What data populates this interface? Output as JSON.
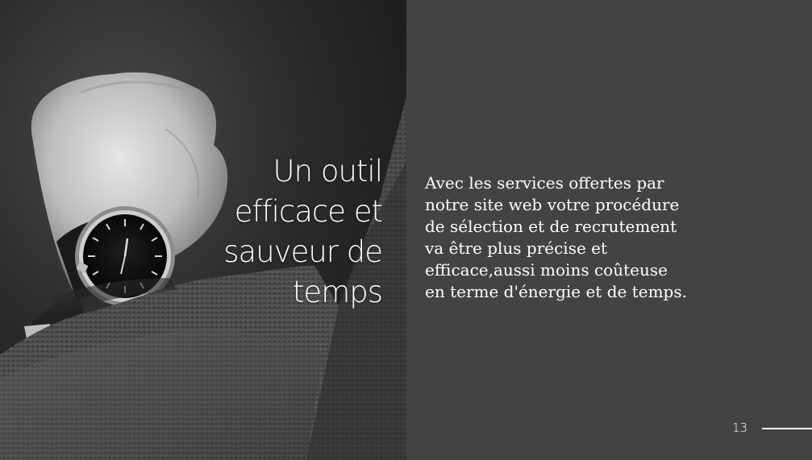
{
  "slide": {
    "title": "Un outil\nefficace et\nsauveur de\ntemps",
    "body": "Avec les services offertes par\nnotre site web votre procédure\nde sélection et de recrutement\nva être plus précise  et\nefficace,aussi moins coûteuse\nen terme d'énergie et de temps.",
    "page_number": "13",
    "image_subject": "wristwatch-on-wrist"
  },
  "colors": {
    "panel_background": "#434343",
    "text": "#ffffff"
  }
}
